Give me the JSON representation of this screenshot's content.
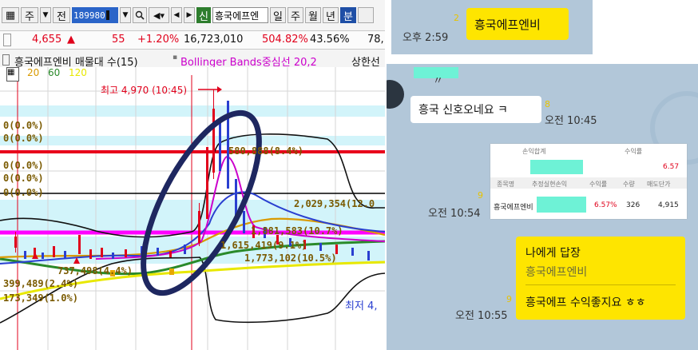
{
  "toolbar": {
    "menu_left": "주",
    "label_jeon": "전",
    "stock_code": "189980",
    "label_sin": "신",
    "stock_name": "흥국에프엔",
    "periods": [
      "일",
      "주",
      "월",
      "년"
    ],
    "period_active": "분"
  },
  "quote": {
    "price": "4,655",
    "change_arrow": "▲",
    "change": "55",
    "change_pct": "+1.20%",
    "volume": "16,723,010",
    "volume_ratio": "504.82%",
    "turnover": "43.56%",
    "extra": "78,"
  },
  "indicator_legend": {
    "title": "흥국에프엔비 매물대 수(15)",
    "bollinger": "Bollinger Bands중심선 20,2",
    "upper": "상한선"
  },
  "ma_legend": [
    "20",
    "60",
    "120"
  ],
  "chart_labels": {
    "high": "최고 4,970 (10:45)",
    "low": "최저 4,",
    "vp1": "0(0.0%)",
    "vp2": "0(0.0%)",
    "vp3": "0(0.0%)",
    "vp4": "0(0.0%)",
    "vp5": "0(0.0%)",
    "vp_big": "580,888(8.4%)",
    "vp_a": "2,029,354(12.0",
    "vp_b": "1,881,583(10.7%)",
    "vp_c": "1,615,419(9.1%)",
    "vp_d": "1,773,102(10.5%)",
    "vp_e": "737,498(4.4%)",
    "vp_f": "399,489(2.4%)",
    "vp_g": "173,349(1.0%)"
  },
  "chat_top": {
    "unread": "2",
    "time": "오후 2:59",
    "message": "흥국에프엔비"
  },
  "chat_main": {
    "msg1": "흥국 신호오네요 ㅋ",
    "msg1_unread": "8",
    "msg1_time": "오전 10:45",
    "card_unread": "9",
    "card_time": "오전 10:54",
    "card_head_top": [
      "손익합계",
      "수익률"
    ],
    "card_top_value": "6.57",
    "card_headers": [
      "종목명",
      "추정실현손익",
      "수익률",
      "수량",
      "매도단가"
    ],
    "card_row": [
      "흥국에프엔비",
      "",
      "6.57%",
      "326",
      "4,915"
    ],
    "reply_title": "나에게 답장",
    "reply_quote": "흥국에프엔비",
    "reply_text": "흥국에프 수익좋지요 ㅎㅎ",
    "reply_unread": "9",
    "reply_time": "오전 10:55"
  },
  "colors": {
    "up": "#e0001b",
    "bb": "#cc00cc",
    "circle": "#1e2760",
    "chat_bg": "#b2c7d9",
    "bubble": "#fee500"
  },
  "chart_data": {
    "type": "candlestick",
    "series": [
      {
        "name": "20",
        "color": "#d99a00"
      },
      {
        "name": "60",
        "color": "#2a8a2a"
      },
      {
        "name": "120",
        "color": "#e8e800"
      }
    ],
    "high": {
      "value": 4970,
      "time": "10:45"
    }
  }
}
